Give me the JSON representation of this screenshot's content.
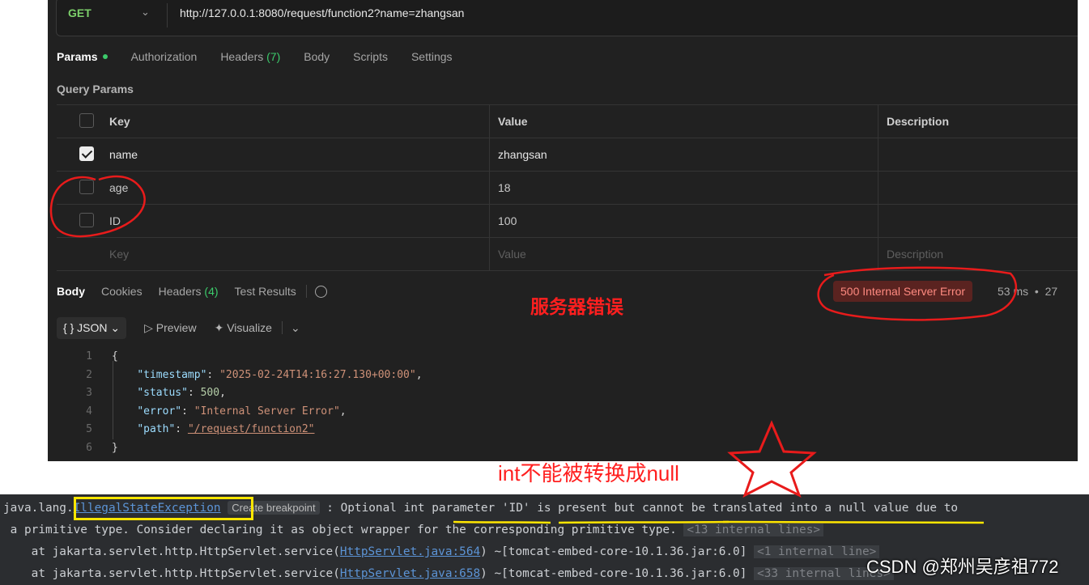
{
  "request": {
    "method": "GET",
    "url": "http://127.0.0.1:8080/request/function2?name=zhangsan"
  },
  "request_tabs": {
    "params": "Params",
    "authorization": "Authorization",
    "headers": "Headers",
    "headers_count": "(7)",
    "body": "Body",
    "scripts": "Scripts",
    "settings": "Settings"
  },
  "query_params": {
    "title": "Query Params",
    "columns": {
      "key": "Key",
      "value": "Value",
      "description": "Description"
    },
    "rows": [
      {
        "key": "name",
        "value": "zhangsan",
        "checked": true
      },
      {
        "key": "age",
        "value": "18",
        "checked": false
      },
      {
        "key": "ID",
        "value": "100",
        "checked": false
      }
    ],
    "placeholder": {
      "key": "Key",
      "value": "Value",
      "description": "Description"
    }
  },
  "response": {
    "tabs": {
      "body": "Body",
      "cookies": "Cookies",
      "headers": "Headers",
      "headers_count": "(4)",
      "test_results": "Test Results"
    },
    "status": "500 Internal Server Error",
    "time": "53 ms",
    "size": "27",
    "format": "{ } JSON",
    "preview": "Preview",
    "visualize": "Visualize",
    "code_lines": [
      {
        "no": "1"
      },
      {
        "no": "2",
        "key": "\"timestamp\"",
        "value": "\"2025-02-24T14:16:27.130+00:00\""
      },
      {
        "no": "3",
        "key": "\"status\"",
        "value": "500"
      },
      {
        "no": "4",
        "key": "\"error\"",
        "value": "\"Internal Server Error\""
      },
      {
        "no": "5",
        "key": "\"path\"",
        "value": "\"/request/function2\""
      },
      {
        "no": "6"
      }
    ]
  },
  "annotations": {
    "server_error": "服务器错误",
    "int_null": "int不能被转换成null",
    "color": "#ff1f1f",
    "box_color": "#ffe600",
    "underline_color": "#ffe600"
  },
  "console": {
    "line1_prefix": "java.lang.",
    "exception": "IllegalStateException",
    "breakpoint": "Create breakpoint",
    "line1_rest": " : Optional int parameter 'ID' is present but cannot be translated into a null value due to",
    "line2": " a primitive type. Consider declaring it as object wrapper for the corresponding primitive type.",
    "line2_fold": "<13 internal lines>",
    "line3_prefix": "    at jakarta.servlet.http.HttpServlet.service(",
    "line3_link": "HttpServlet.java:564",
    "line3_rest": ") ~[tomcat-embed-core-10.1.36.jar:6.0]",
    "line3_fold": "<1 internal line>",
    "line4_prefix": "    at jakarta.servlet.http.HttpServlet.service(",
    "line4_link": "HttpServlet.java:658",
    "line4_rest": ") ~[tomcat-embed-core-10.1.36.jar:6.0]",
    "line4_fold": "<33 internal lines>"
  },
  "watermark": "CSDN @郑州吴彦祖772"
}
